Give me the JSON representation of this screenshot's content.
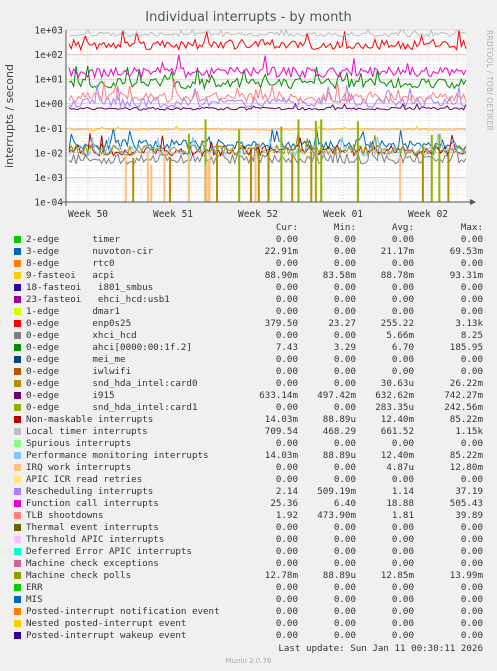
{
  "title": "Individual interrupts - by month",
  "side_label": "RRDTOOL / TOBI OETIKER",
  "footer": {
    "last_update": "Last update: Sun Jan 11 00:30:11 2026",
    "version": "Munin 2.0.76"
  },
  "legend_headers": [
    "Cur:",
    "Min:",
    "Avg:",
    "Max:"
  ],
  "chart_data": {
    "type": "line",
    "title": "Individual interrupts - by month",
    "ylabel": "interrupts / second",
    "yscale": "log",
    "ylim": [
      0.0001,
      1000
    ],
    "y_ticks": [
      "1e-04",
      "1e-03",
      "1e-02",
      "1e-01",
      "1e+00",
      "1e+01",
      "1e+02",
      "1e+03"
    ],
    "x_ticks": [
      "Week 50",
      "Week 51",
      "Week 52",
      "Week 01",
      "Week 02"
    ],
    "grid": true,
    "series": [
      {
        "name": "2-edge      timer",
        "color": "#00cc00",
        "values": [
          "0.00",
          "0.00",
          "0.00",
          "0.00"
        ]
      },
      {
        "name": "3-edge      nuvoton-cir",
        "color": "#0066b3",
        "values": [
          "22.91m",
          "0.00",
          "21.17m",
          "69.53m"
        ]
      },
      {
        "name": "8-edge      rtc0",
        "color": "#ff8000",
        "values": [
          "0.00",
          "0.00",
          "0.00",
          "0.00"
        ]
      },
      {
        "name": "9-fasteoi   acpi",
        "color": "#ffcc00",
        "values": [
          "88.90m",
          "83.58m",
          "88.78m",
          "93.31m"
        ]
      },
      {
        "name": "18-fasteoi   i801_smbus",
        "color": "#330099",
        "values": [
          "0.00",
          "0.00",
          "0.00",
          "0.00"
        ]
      },
      {
        "name": "23-fasteoi   ehci_hcd:usb1",
        "color": "#990099",
        "values": [
          "0.00",
          "0.00",
          "0.00",
          "0.00"
        ]
      },
      {
        "name": "1-edge      dmar1",
        "color": "#ccff00",
        "values": [
          "0.00",
          "0.00",
          "0.00",
          "0.00"
        ]
      },
      {
        "name": "0-edge      enp0s25",
        "color": "#ff0000",
        "values": [
          "379.50",
          "23.27",
          "255.22",
          "3.13k"
        ]
      },
      {
        "name": "0-edge      xhci_hcd",
        "color": "#808080",
        "values": [
          "0.00",
          "0.00",
          "5.66m",
          "8.25"
        ]
      },
      {
        "name": "0-edge      ahci[0000:00:1f.2]",
        "color": "#008f00",
        "values": [
          "7.43",
          "3.29",
          "6.70",
          "185.95"
        ]
      },
      {
        "name": "0-edge      mei_me",
        "color": "#00487d",
        "values": [
          "0.00",
          "0.00",
          "0.00",
          "0.00"
        ]
      },
      {
        "name": "0-edge      iwlwifi",
        "color": "#b35a00",
        "values": [
          "0.00",
          "0.00",
          "0.00",
          "0.00"
        ]
      },
      {
        "name": "0-edge      snd_hda_intel:card0",
        "color": "#b38f00",
        "values": [
          "0.00",
          "0.00",
          "30.63u",
          "26.22m"
        ]
      },
      {
        "name": "0-edge      i915",
        "color": "#6b006b",
        "values": [
          "633.14m",
          "497.42m",
          "632.62m",
          "742.27m"
        ]
      },
      {
        "name": "0-edge      snd_hda_intel:card1",
        "color": "#8fb300",
        "values": [
          "0.00",
          "0.00",
          "283.35u",
          "242.56m"
        ]
      },
      {
        "name": "Non-maskable interrupts",
        "color": "#b30000",
        "values": [
          "14.03m",
          "88.89u",
          "12.40m",
          "85.22m"
        ]
      },
      {
        "name": "Local timer interrupts",
        "color": "#bebebe",
        "values": [
          "709.54",
          "468.29",
          "661.52",
          "1.15k"
        ]
      },
      {
        "name": "Spurious interrupts",
        "color": "#80ff80",
        "values": [
          "0.00",
          "0.00",
          "0.00",
          "0.00"
        ]
      },
      {
        "name": "Performance monitoring interrupts",
        "color": "#80c9ff",
        "values": [
          "14.03m",
          "88.89u",
          "12.40m",
          "85.22m"
        ]
      },
      {
        "name": "IRQ work interrupts",
        "color": "#ffc080",
        "values": [
          "0.00",
          "0.00",
          "4.87u",
          "12.80m"
        ]
      },
      {
        "name": "APIC ICR read retries",
        "color": "#ffe680",
        "values": [
          "0.00",
          "0.00",
          "0.00",
          "0.00"
        ]
      },
      {
        "name": "Rescheduling interrupts",
        "color": "#aa80ff",
        "values": [
          "2.14",
          "509.19m",
          "1.14",
          "37.19"
        ]
      },
      {
        "name": "Function call interrupts",
        "color": "#ee00cc",
        "values": [
          "25.36",
          "6.40",
          "18.88",
          "505.43"
        ]
      },
      {
        "name": "TLB shootdowns",
        "color": "#ff8080",
        "values": [
          "1.92",
          "473.90m",
          "1.81",
          "39.89"
        ]
      },
      {
        "name": "Thermal event interrupts",
        "color": "#666600",
        "values": [
          "0.00",
          "0.00",
          "0.00",
          "0.00"
        ]
      },
      {
        "name": "Threshold APIC interrupts",
        "color": "#ffbfff",
        "values": [
          "0.00",
          "0.00",
          "0.00",
          "0.00"
        ]
      },
      {
        "name": "Deferred Error APIC interrupts",
        "color": "#00ffcc",
        "values": [
          "0.00",
          "0.00",
          "0.00",
          "0.00"
        ]
      },
      {
        "name": "Machine check exceptions",
        "color": "#cc6699",
        "values": [
          "0.00",
          "0.00",
          "0.00",
          "0.00"
        ]
      },
      {
        "name": "Machine check polls",
        "color": "#999900",
        "values": [
          "12.78m",
          "88.89u",
          "12.85m",
          "13.99m"
        ]
      },
      {
        "name": "ERR",
        "color": "#00cc00",
        "values": [
          "0.00",
          "0.00",
          "0.00",
          "0.00"
        ]
      },
      {
        "name": "MIS",
        "color": "#0066b3",
        "values": [
          "0.00",
          "0.00",
          "0.00",
          "0.00"
        ]
      },
      {
        "name": "Posted-interrupt notification event",
        "color": "#ff8000",
        "values": [
          "0.00",
          "0.00",
          "0.00",
          "0.00"
        ]
      },
      {
        "name": "Nested posted-interrupt event",
        "color": "#ffcc00",
        "values": [
          "0.00",
          "0.00",
          "0.00",
          "0.00"
        ]
      },
      {
        "name": "Posted-interrupt wakeup event",
        "color": "#330099",
        "values": [
          "0.00",
          "0.00",
          "0.00",
          "0.00"
        ]
      }
    ]
  }
}
